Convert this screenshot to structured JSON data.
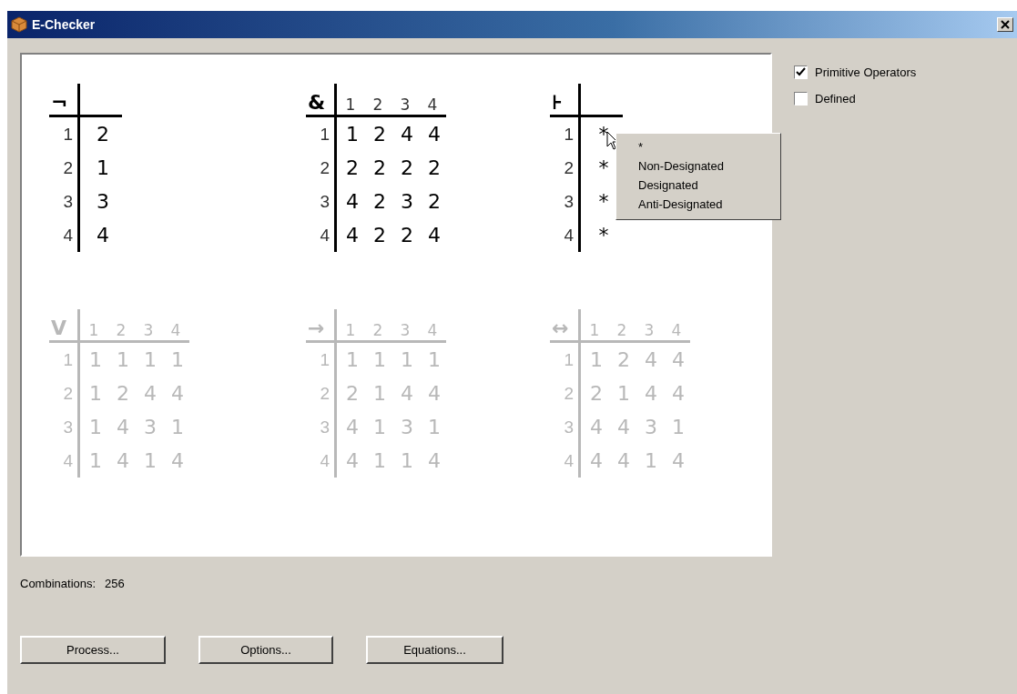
{
  "window": {
    "title": "E-Checker"
  },
  "tables": [
    {
      "operator": "¬",
      "enabled": true,
      "rows": [
        {
          "label": "1",
          "values": [
            "2"
          ]
        },
        {
          "label": "2",
          "values": [
            "1"
          ]
        },
        {
          "label": "3",
          "values": [
            "3"
          ]
        },
        {
          "label": "4",
          "values": [
            "4"
          ]
        }
      ]
    },
    {
      "operator": "&",
      "enabled": true,
      "columns": [
        "1",
        "2",
        "3",
        "4"
      ],
      "rows": [
        {
          "label": "1",
          "values": [
            "1",
            "2",
            "4",
            "4"
          ]
        },
        {
          "label": "2",
          "values": [
            "2",
            "2",
            "2",
            "2"
          ]
        },
        {
          "label": "3",
          "values": [
            "4",
            "2",
            "3",
            "2"
          ]
        },
        {
          "label": "4",
          "values": [
            "4",
            "2",
            "2",
            "4"
          ]
        }
      ]
    },
    {
      "operator": "⊦",
      "enabled": true,
      "rows": [
        {
          "label": "1",
          "values": [
            "*"
          ]
        },
        {
          "label": "2",
          "values": [
            "*"
          ]
        },
        {
          "label": "3",
          "values": [
            "*"
          ]
        },
        {
          "label": "4",
          "values": [
            "*"
          ]
        }
      ],
      "context_menu": {
        "items": [
          "*",
          "Non-Designated",
          "Designated",
          "Anti-Designated"
        ]
      }
    },
    {
      "operator": "V",
      "enabled": false,
      "columns": [
        "1",
        "2",
        "3",
        "4"
      ],
      "rows": [
        {
          "label": "1",
          "values": [
            "1",
            "1",
            "1",
            "1"
          ]
        },
        {
          "label": "2",
          "values": [
            "1",
            "2",
            "4",
            "4"
          ]
        },
        {
          "label": "3",
          "values": [
            "1",
            "4",
            "3",
            "1"
          ]
        },
        {
          "label": "4",
          "values": [
            "1",
            "4",
            "1",
            "4"
          ]
        }
      ]
    },
    {
      "operator": "→",
      "enabled": false,
      "columns": [
        "1",
        "2",
        "3",
        "4"
      ],
      "rows": [
        {
          "label": "1",
          "values": [
            "1",
            "1",
            "1",
            "1"
          ]
        },
        {
          "label": "2",
          "values": [
            "2",
            "1",
            "4",
            "4"
          ]
        },
        {
          "label": "3",
          "values": [
            "4",
            "1",
            "3",
            "1"
          ]
        },
        {
          "label": "4",
          "values": [
            "4",
            "1",
            "1",
            "4"
          ]
        }
      ]
    },
    {
      "operator": "↔",
      "enabled": false,
      "columns": [
        "1",
        "2",
        "3",
        "4"
      ],
      "rows": [
        {
          "label": "1",
          "values": [
            "1",
            "2",
            "4",
            "4"
          ]
        },
        {
          "label": "2",
          "values": [
            "2",
            "1",
            "4",
            "4"
          ]
        },
        {
          "label": "3",
          "values": [
            "4",
            "4",
            "3",
            "1"
          ]
        },
        {
          "label": "4",
          "values": [
            "4",
            "4",
            "1",
            "4"
          ]
        }
      ]
    }
  ],
  "options": [
    {
      "label": "Primitive Operators",
      "checked": true
    },
    {
      "label": "Defined",
      "checked": false
    }
  ],
  "combinations": {
    "label": "Combinations:",
    "value": "256"
  },
  "buttons": [
    "Process...",
    "Options...",
    "Equations..."
  ]
}
